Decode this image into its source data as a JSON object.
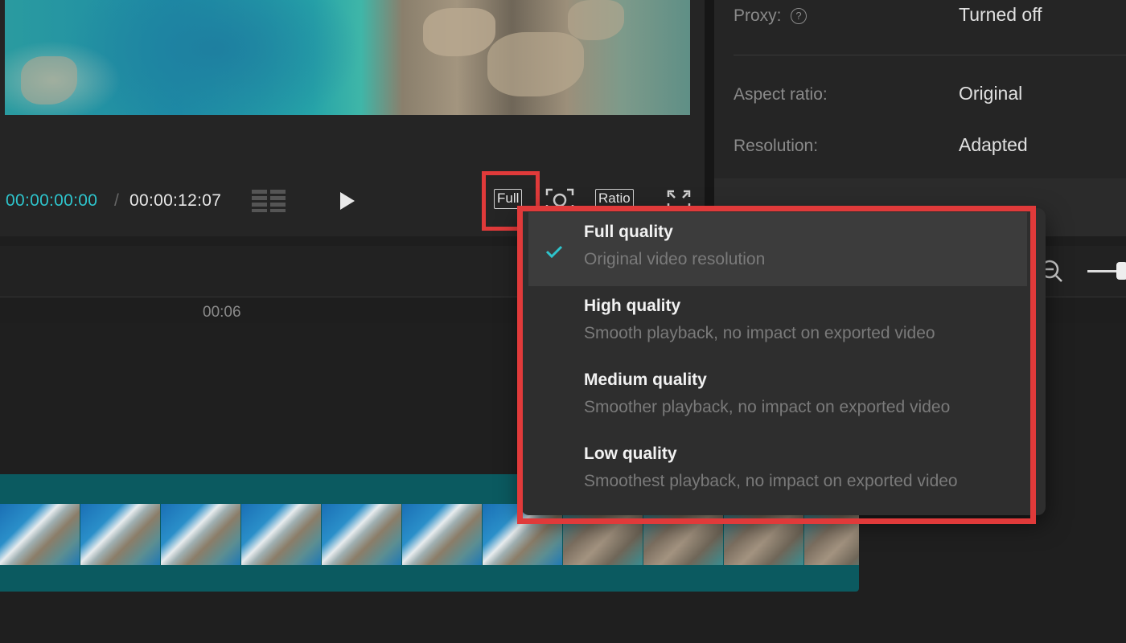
{
  "player": {
    "current_time": "00:00:00:00",
    "separator": "/",
    "total_time": "00:00:12:07",
    "full_label": "Full",
    "ratio_label": "Ratio"
  },
  "properties": {
    "proxy_label": "Proxy:",
    "proxy_help": "?",
    "proxy_value": "Turned off",
    "aspect_label": "Aspect ratio:",
    "aspect_value": "Original",
    "resolution_label": "Resolution:",
    "resolution_value": "Adapted"
  },
  "timeline": {
    "ruler_label": "00:06"
  },
  "quality_menu": {
    "items": [
      {
        "title": "Full quality",
        "description": "Original video resolution",
        "selected": true
      },
      {
        "title": "High quality",
        "description": "Smooth playback, no impact on exported video",
        "selected": false
      },
      {
        "title": "Medium quality",
        "description": "Smoother playback, no impact on exported video",
        "selected": false
      },
      {
        "title": "Low quality",
        "description": "Smoothest playback, no impact on exported video",
        "selected": false
      }
    ]
  },
  "colors": {
    "accent": "#2ec4cc",
    "highlight": "#e03a3a",
    "clip": "#0b5a60"
  },
  "icons": [
    "grid-icon",
    "play-icon",
    "snapshot-icon",
    "fullscreen-icon",
    "help-icon",
    "zoom-out-icon",
    "check-icon"
  ]
}
